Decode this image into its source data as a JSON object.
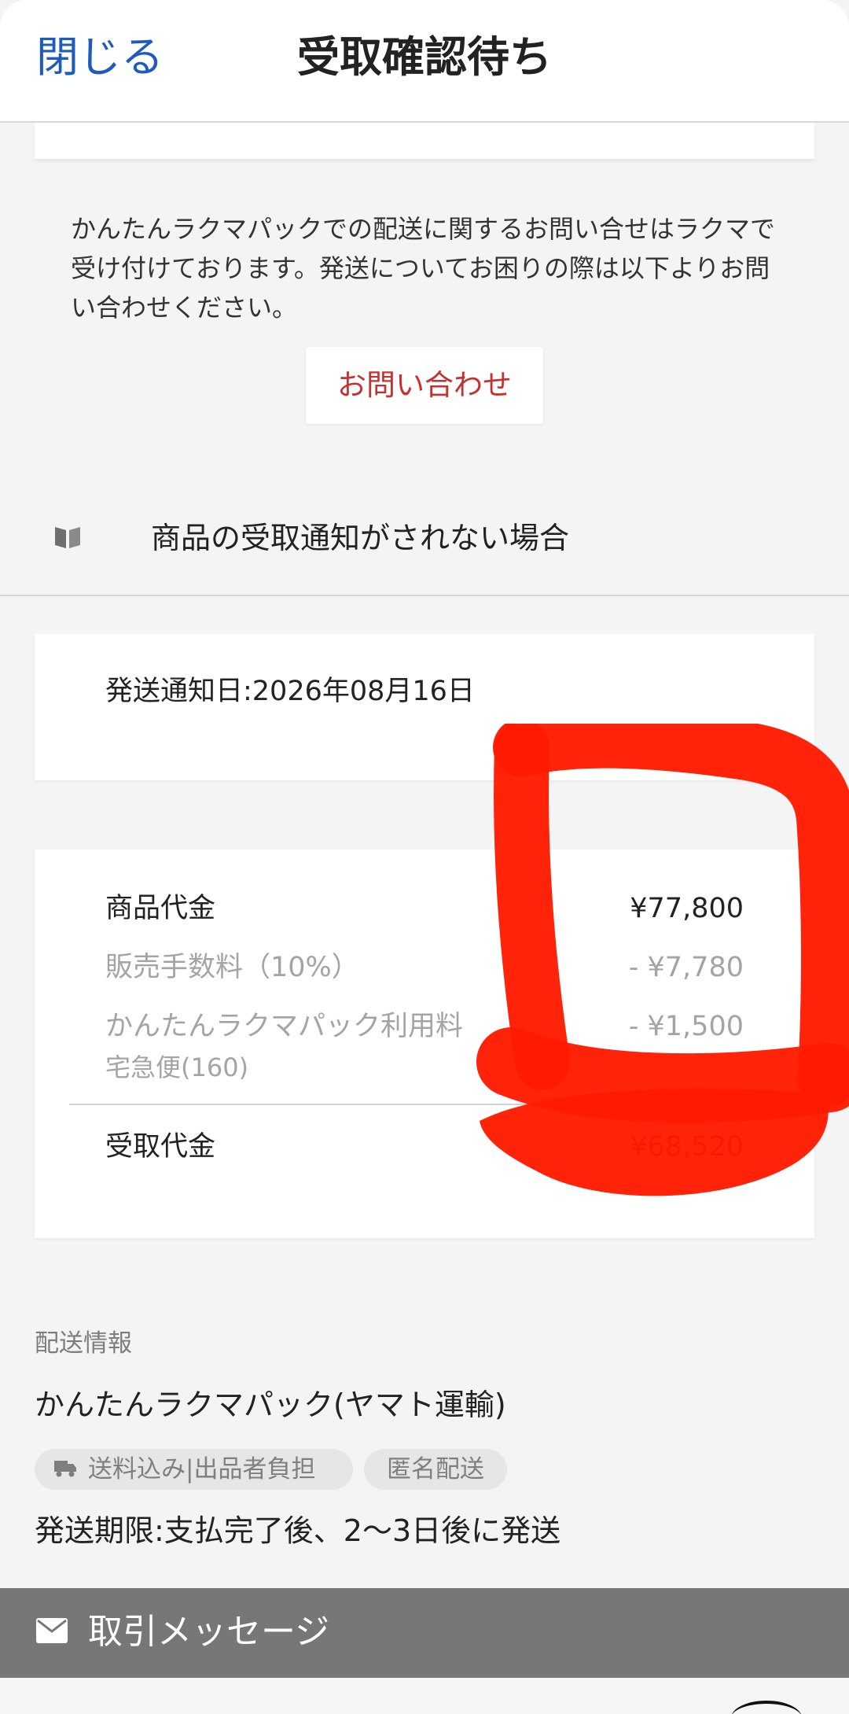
{
  "header": {
    "close_label": "閉じる",
    "title": "受取確認待ち"
  },
  "notice": {
    "text": "かんたんラクマパックでの配送に関するお問い合せはラクマで受け付けております。発送についてお困りの際は以下よりお問い合わせください。",
    "contact_button": "お問い合わせ"
  },
  "help": {
    "icon": "book-icon",
    "label": "商品の受取通知がされない場合"
  },
  "shipment": {
    "ship_date": "発送通知日:2026年08月16日"
  },
  "price": {
    "item_price_label": "商品代金",
    "item_price_value": "¥77,800",
    "fee_label": "販売手数料（10%）",
    "fee_value": "- ¥7,780",
    "pack_fee_label": "かんたんラクマパック利用料",
    "pack_fee_sub_label": "宅急便(160)",
    "pack_fee_value": "- ¥1,500",
    "received_label": "受取代金",
    "received_value": "¥68,520"
  },
  "shipping_info": {
    "heading": "配送情報",
    "method": "かんたんラクマパック(ヤマト運輸)",
    "tags": [
      {
        "icon": "truck-icon",
        "label": "送料込み|出品者負担"
      },
      {
        "label": "匿名配送"
      }
    ],
    "deadline": "発送期限:支払完了後、2〜3日後に発送"
  },
  "message": {
    "icon": "mail-icon",
    "label": "取引メッセージ"
  },
  "colors": {
    "accent_blue": "#1f5bbd",
    "contact_red": "#c8302f",
    "scribble_red": "#ff1a00",
    "message_bar": "#777777"
  }
}
